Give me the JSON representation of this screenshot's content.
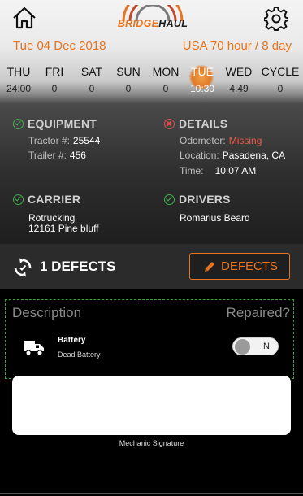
{
  "header": {
    "logo": {
      "part1": "BRIDGE",
      "part2": "HAUL"
    },
    "date": "Tue 04 Dec 2018",
    "cycle_rule": "USA 70 hour / 8 day",
    "brand_color": "#e8741f"
  },
  "week": {
    "days": [
      {
        "name": "THU",
        "value": "24:00"
      },
      {
        "name": "FRI",
        "value": "0"
      },
      {
        "name": "SAT",
        "value": "0"
      },
      {
        "name": "SUN",
        "value": "0"
      },
      {
        "name": "MON",
        "value": "0"
      },
      {
        "name": "TUE",
        "value": "10:30"
      },
      {
        "name": "WED",
        "value": "4:49"
      },
      {
        "name": "CYCLE",
        "value": "0"
      }
    ],
    "active_day": "TUE"
  },
  "equipment": {
    "title": "EQUIPMENT",
    "status_icon": "check-circle-icon",
    "tractor_label": "Tractor #:",
    "tractor_value": "25544",
    "trailer_label": "Trailer #:",
    "trailer_value": "456"
  },
  "details": {
    "title": "DETAILS",
    "status_icon": "x-circle-icon",
    "odometer_label": "Odometer:",
    "odometer_value": "Missing",
    "location_label": "Location:",
    "location_value": "Pasadena, CA",
    "time_label": "Time:",
    "time_value": "10:07 AM"
  },
  "carrier": {
    "title": "CARRIER",
    "status_icon": "check-circle-icon",
    "name": "Rotrucking",
    "address": "12161 Pine bluff"
  },
  "drivers": {
    "title": "DRIVERS",
    "status_icon": "check-circle-icon",
    "name": "Romarius Beard"
  },
  "defects": {
    "count_label": "1 DEFECTS",
    "button_label": "DEFECTS",
    "description_header": "Description",
    "repaired_header": "Repaired?",
    "items": [
      {
        "title": "Battery",
        "subtitle": "Dead Battery",
        "repaired": "N",
        "icon": "truck-icon"
      }
    ]
  },
  "signature": {
    "label": "Mechanic Signature"
  }
}
